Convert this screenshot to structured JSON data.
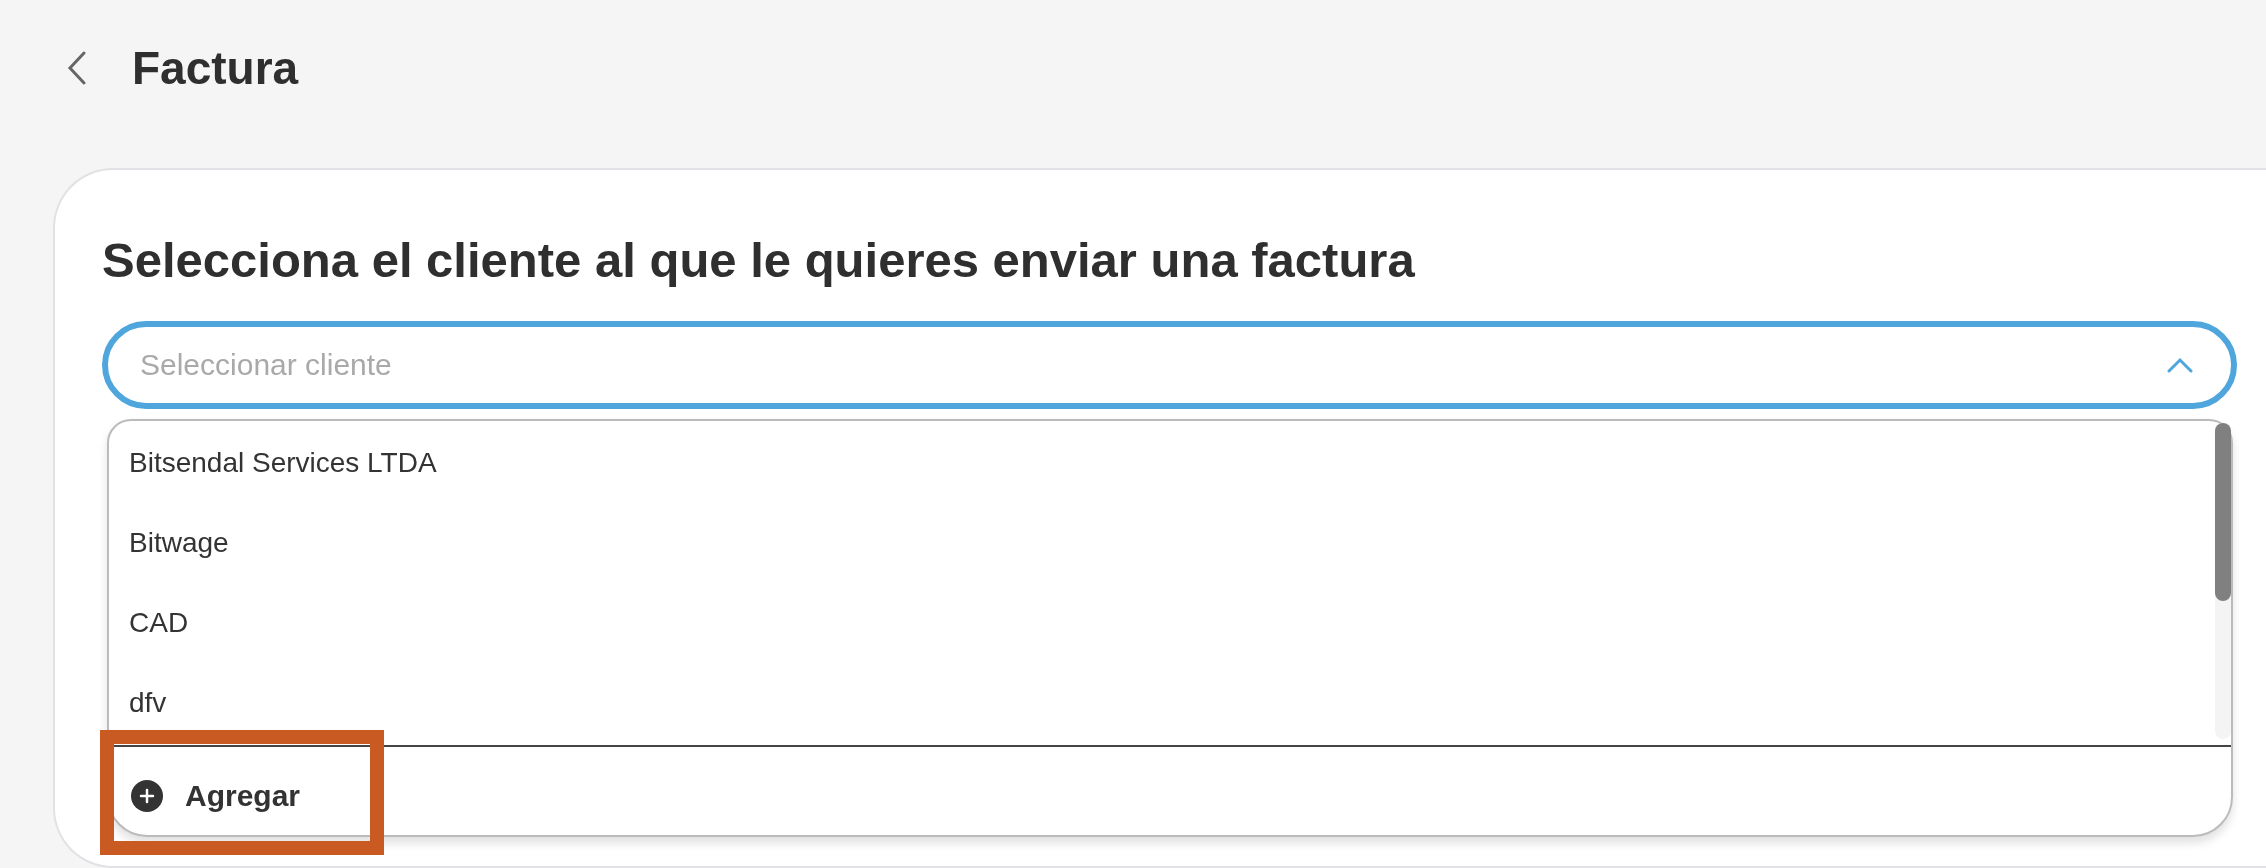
{
  "header": {
    "title": "Factura"
  },
  "card": {
    "heading": "Selecciona el cliente al que le quieres enviar una factura",
    "client_select": {
      "placeholder": "Seleccionar cliente",
      "expanded": true
    },
    "options": [
      {
        "label": "Bitsendal Services LTDA"
      },
      {
        "label": "Bitwage"
      },
      {
        "label": "CAD"
      },
      {
        "label": "dfv"
      }
    ],
    "add_action": {
      "label": "Agregar"
    }
  }
}
